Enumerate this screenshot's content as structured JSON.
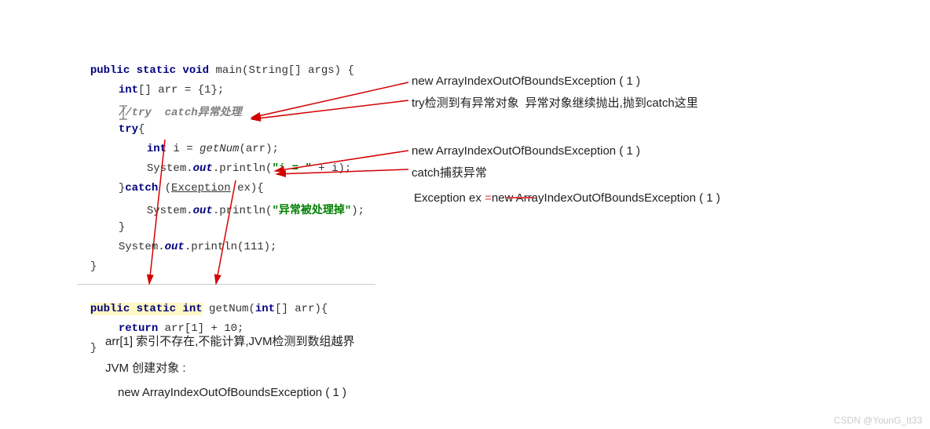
{
  "main": {
    "sig_pre": "public static void",
    "sig_name": " main(String[] args) {",
    "l1_pre": "int",
    "l1_rest": "[] arr = {1};",
    "comment": "//try  catch异常处理",
    "try_kw": "try",
    "try_brace": "{",
    "l_int": "int",
    "l_i_eq": " i = ",
    "l_getnum": "getNum",
    "l_getnum_arg": "(arr);",
    "sop1_sys": "System.",
    "sop1_out": "out",
    "sop1_rest": ".println(",
    "sop1_str": "\"i = \"",
    "sop1_tail": " + i);",
    "catch_pre": "}",
    "catch_kw": "catch",
    "catch_arg_open": " (",
    "catch_exc": "Exception",
    "catch_arg_close": " ex){",
    "sop2_sys": "System.",
    "sop2_out": "out",
    "sop2_rest": ".println(",
    "sop2_str": "\"异常被处理掉\"",
    "sop2_tail": ");",
    "close_catch": "}",
    "sop3_sys": "System.",
    "sop3_out": "out",
    "sop3_rest": ".println(111);",
    "close_main": "}"
  },
  "getnum": {
    "sig_kw": "public static int",
    "sig_name": " getNum(",
    "sig_param_kw": "int",
    "sig_param_rest": "[] arr){",
    "ret_kw": "return",
    "ret_rest": " arr[1] + 10;",
    "close": "}"
  },
  "annot": {
    "a1": "new ArrayIndexOutOfBoundsException ( 1 )",
    "a2a": "try检测到有异常对象",
    "a2b": "异常对象继续抛出,抛到catch这里",
    "a3": "new ArrayIndexOutOfBoundsException ( 1 )",
    "a4": "catch捕获异常",
    "a5a": "Exception ex ",
    "a5b": "=",
    "a5c": "new ArrayIndexOutOfBoundsException ( 1 )",
    "b1": "arr[1] 索引不存在,不能计算,JVM检测到数组越界",
    "b2": "JVM 创建对象 :",
    "b3": "new ArrayIndexOutOfBoundsException ( 1 )"
  },
  "watermark": "CSDN @YounG_tt33"
}
